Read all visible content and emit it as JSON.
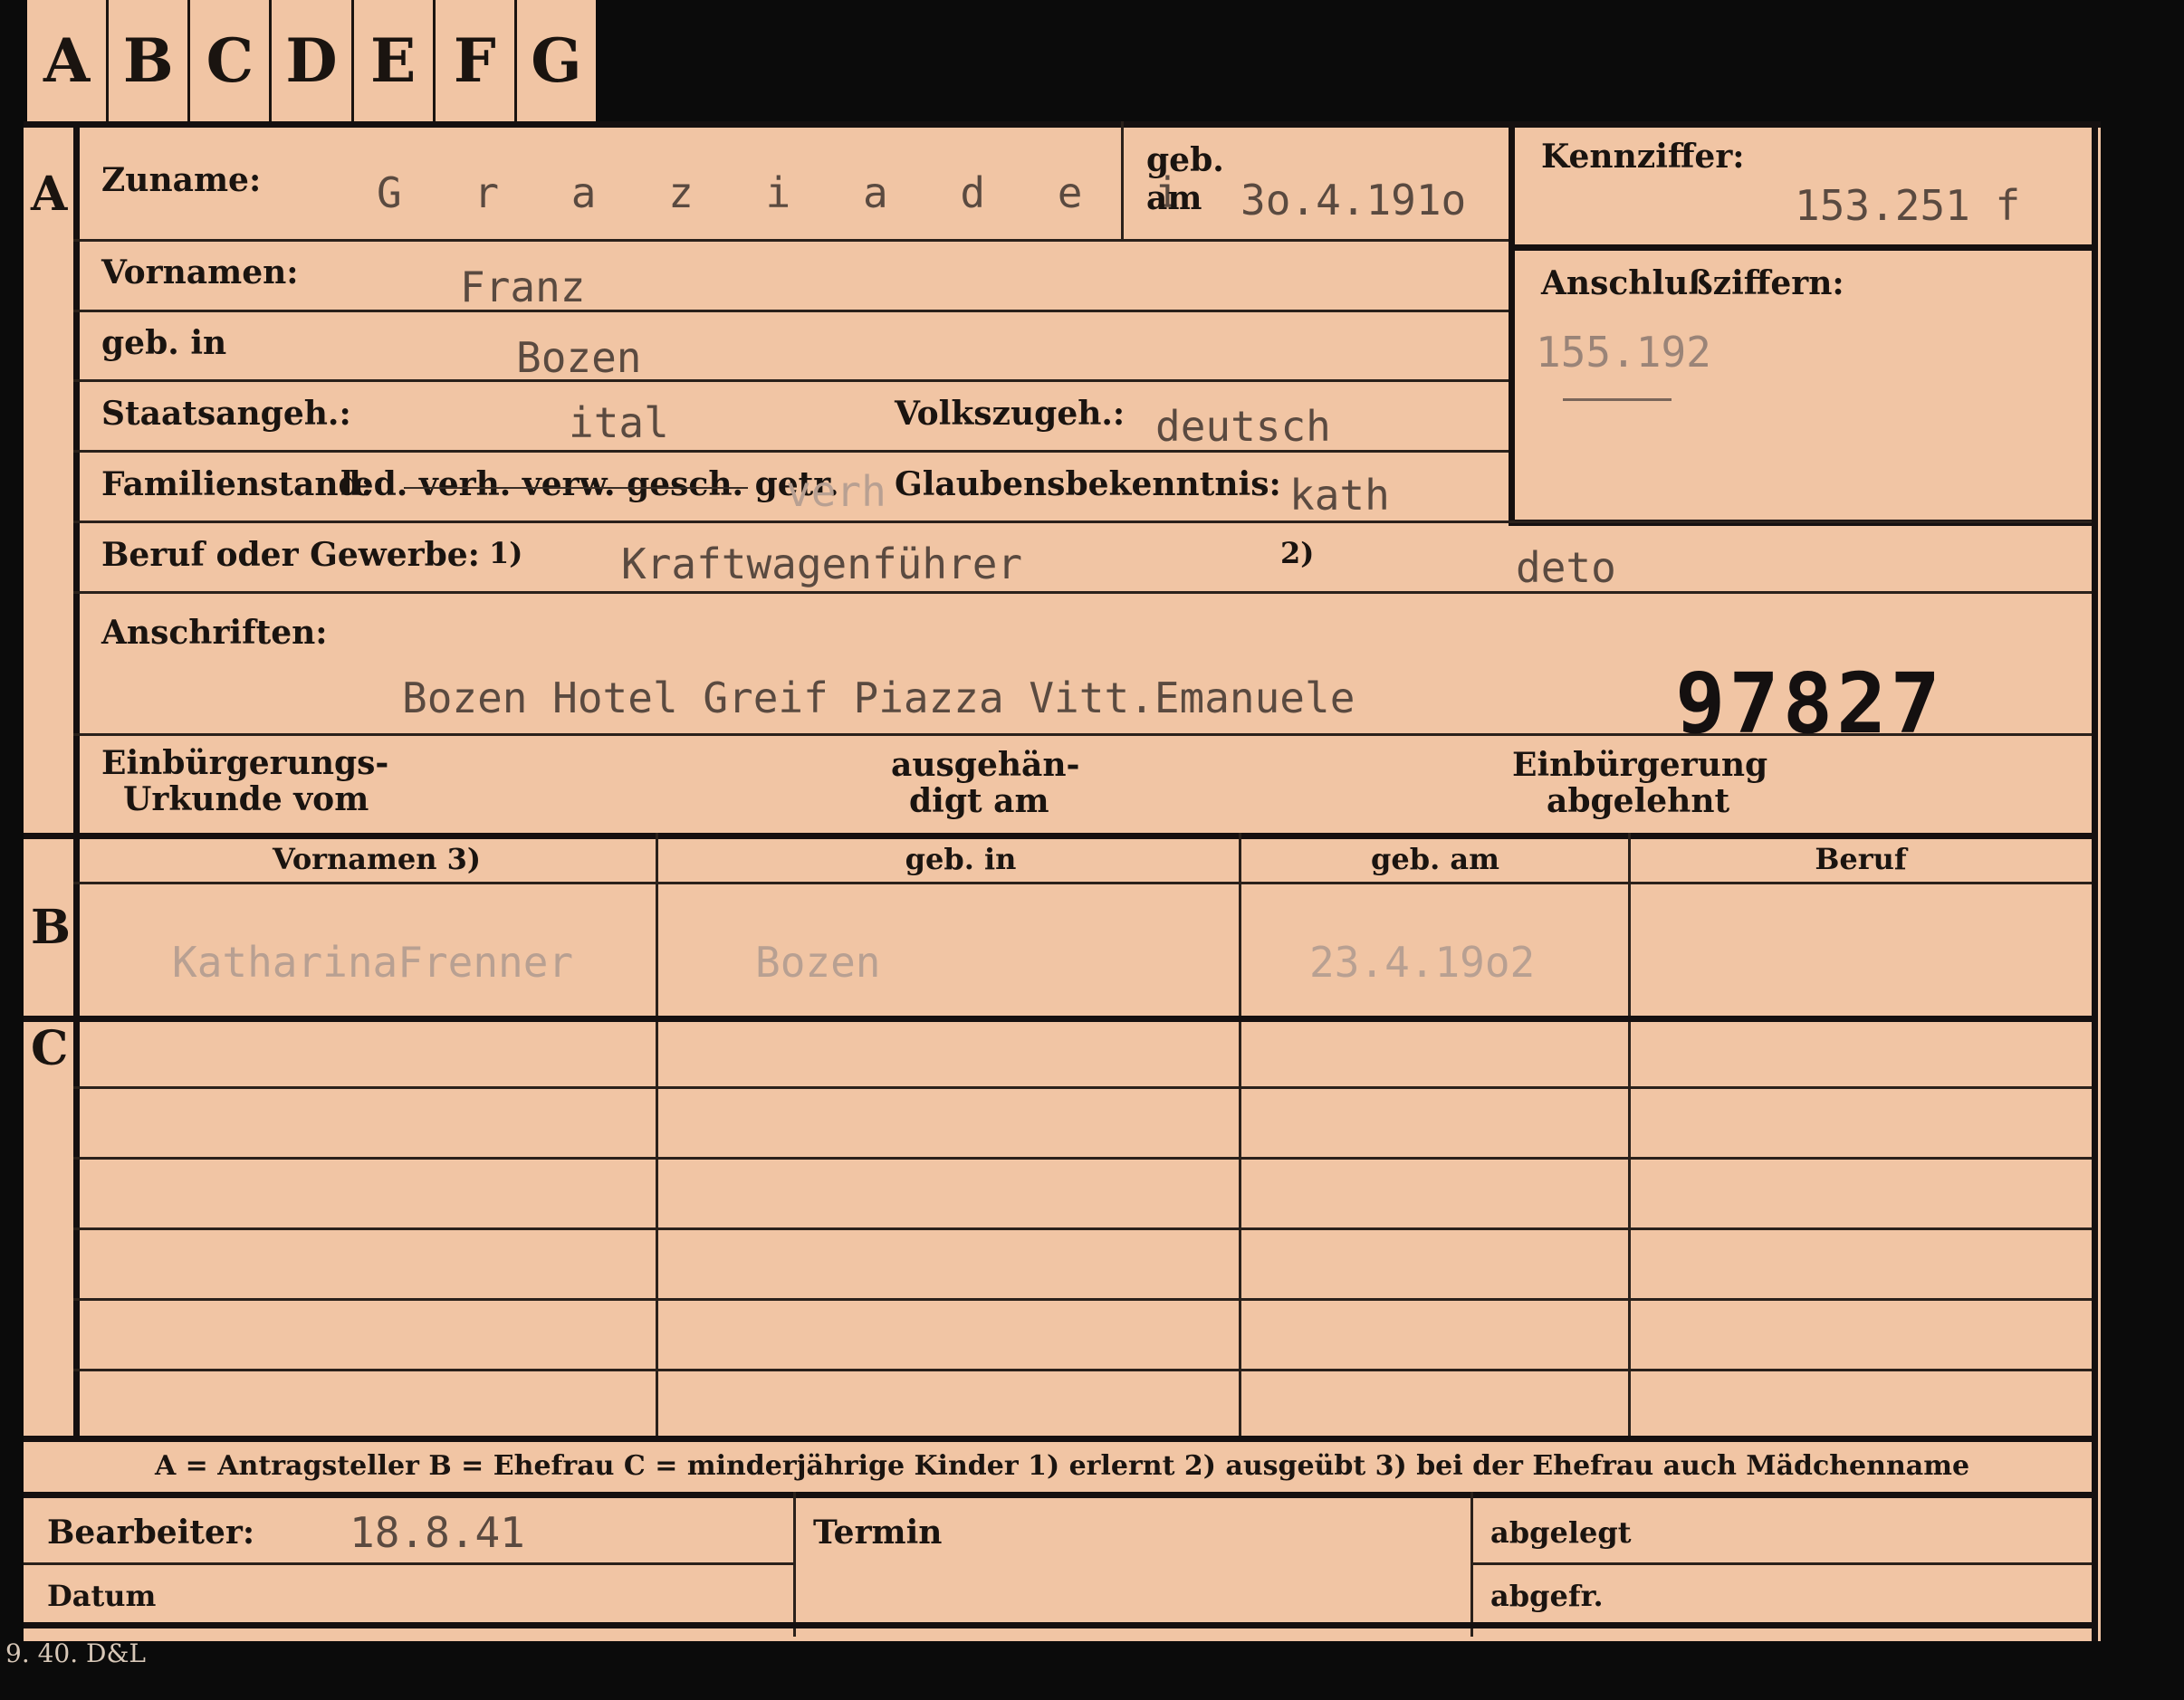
{
  "tabs": [
    "A",
    "B",
    "C",
    "D",
    "E",
    "F",
    "G"
  ],
  "sections": {
    "a": "A",
    "b": "B",
    "c": "C"
  },
  "labels": {
    "zuname": "Zuname:",
    "geb_am_top": "geb.",
    "geb_am_bottom": "am",
    "kennziffer": "Kennziffer:",
    "anschlussziffern": "Anschlußziffern:",
    "vornamen": "Vornamen:",
    "geb_in": "geb. in",
    "staatsangeh": "Staatsangeh.:",
    "volkszugeh": "Volkszugeh.:",
    "familienstand": "Familienstand:",
    "familienstand_options": "led. verh. verw. gesch. getr.",
    "glaubensbekenntnis": "Glaubensbekenntnis:",
    "beruf": "Beruf oder Gewerbe:",
    "fn1": "1)",
    "fn2": "2)",
    "anschriften": "Anschriften:",
    "einbuergerung_urkunde_1": "Einbürgerungs-",
    "einbuergerung_urkunde_2": "Urkunde vom",
    "ausgehaendigt_1": "ausgehän-",
    "ausgehaendigt_2": "digt am",
    "einbuergerung_abgelehnt_1": "Einbürgerung",
    "einbuergerung_abgelehnt_2": "abgelehnt",
    "col_vornamen": "Vornamen 3)",
    "col_geb_in": "geb. in",
    "col_geb_am": "geb. am",
    "col_beruf": "Beruf",
    "legend": "A = Antragsteller    B = Ehefrau    C = minderjährige Kinder    1) erlernt    2) ausgeübt    3) bei der Ehefrau auch Mädchenname",
    "bearbeiter": "Bearbeiter:",
    "termin": "Termin",
    "abgelegt": "abgelegt",
    "datum": "Datum",
    "abgefr": "abgefr."
  },
  "values": {
    "zuname": "G r a z i a d e i",
    "geb_am": "3o.4.191o",
    "kennziffer": "153.251  f",
    "anschlussziffern": "155.192",
    "vornamen": "Franz",
    "geb_in": "Bozen",
    "staatsangeh": "ital",
    "volkszugeh": "deutsch",
    "familienstand": "verh",
    "glaubensbekenntnis": "kath",
    "beruf_erlernt": "Kraftwagenführer",
    "beruf_ausgeuebt": "deto",
    "anschrift": "Bozen Hotel Greif Piazza Vitt.Emanuele",
    "aktennummer": "97827",
    "ehefrau_vornamen": "KatharinaFrenner",
    "ehefrau_geb_in": "Bozen",
    "ehefrau_geb_am": "23.4.19o2",
    "bearbeiter_datum": "18.8.41"
  },
  "footer": "9. 40. D&L"
}
